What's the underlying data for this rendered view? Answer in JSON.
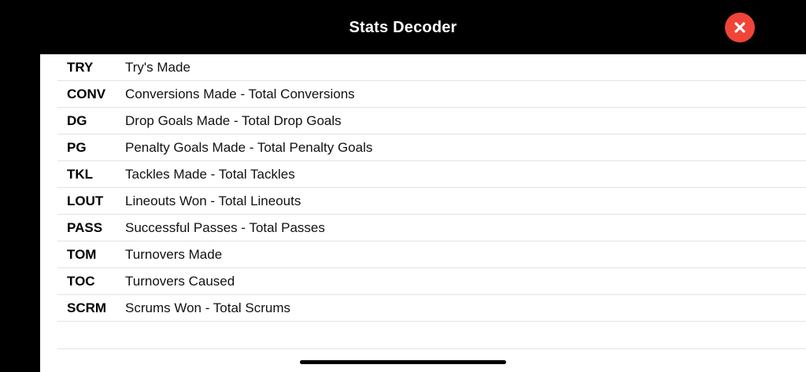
{
  "header": {
    "title": "Stats Decoder",
    "close_icon": "close-x-icon",
    "close_color": "#f04438"
  },
  "stats": [
    {
      "abbr": "TRY",
      "description": "Try's Made"
    },
    {
      "abbr": "CONV",
      "description": "Conversions Made - Total Conversions"
    },
    {
      "abbr": "DG",
      "description": "Drop Goals Made - Total Drop Goals"
    },
    {
      "abbr": "PG",
      "description": "Penalty Goals Made - Total Penalty Goals"
    },
    {
      "abbr": "TKL",
      "description": "Tackles Made - Total Tackles"
    },
    {
      "abbr": "LOUT",
      "description": "Lineouts Won - Total Lineouts"
    },
    {
      "abbr": "PASS",
      "description": "Successful Passes - Total Passes"
    },
    {
      "abbr": "TOM",
      "description": "Turnovers Made"
    },
    {
      "abbr": "TOC",
      "description": "Turnovers Caused"
    },
    {
      "abbr": "SCRM",
      "description": "Scrums Won - Total Scrums"
    }
  ]
}
